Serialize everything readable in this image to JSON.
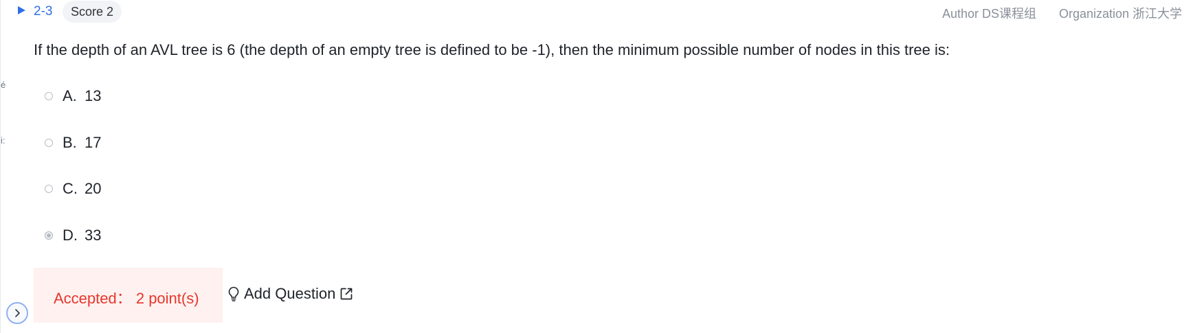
{
  "header": {
    "question_number": "2-3",
    "score_label": "Score 2",
    "author": "Author DS课程组",
    "organization": "Organization 浙江大学"
  },
  "question": {
    "text": "If the depth of an AVL tree is 6 (the depth of an empty tree is defined to be -1), then the minimum possible number of nodes in this tree is:",
    "options": [
      {
        "letter": "A.",
        "text": "13",
        "selected": false
      },
      {
        "letter": "B.",
        "text": "17",
        "selected": false
      },
      {
        "letter": "C.",
        "text": "20",
        "selected": false
      },
      {
        "letter": "D.",
        "text": "33",
        "selected": true
      }
    ]
  },
  "result": {
    "text": "Accepted：  2 point(s)",
    "color": "#e5382b",
    "background": "#fff1f0"
  },
  "actions": {
    "add_question_label": "Add Question"
  },
  "side_glyphs": [
    "é",
    "i:"
  ],
  "colors": {
    "accent": "#2f6fe4",
    "muted_text": "#8a9099"
  }
}
